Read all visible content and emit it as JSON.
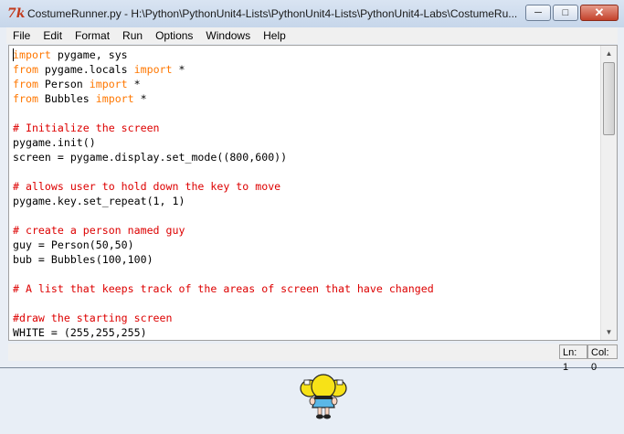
{
  "window": {
    "title": "CostumeRunner.py - H:\\Python\\PythonUnit4-Lists\\PythonUnit4-Lists\\PythonUnit4-Labs\\CostumeRu...",
    "icon": "tk-feather-icon",
    "buttons": {
      "minimize": "minimize-icon",
      "maximize": "maximize-icon",
      "close": "close-icon"
    }
  },
  "menu": {
    "items": [
      "File",
      "Edit",
      "Format",
      "Run",
      "Options",
      "Windows",
      "Help"
    ]
  },
  "editor": {
    "lines": [
      [
        {
          "t": "import",
          "c": "kw"
        },
        {
          "t": " pygame, sys",
          "c": ""
        }
      ],
      [
        {
          "t": "from",
          "c": "kw"
        },
        {
          "t": " pygame.locals ",
          "c": ""
        },
        {
          "t": "import",
          "c": "kw"
        },
        {
          "t": " *",
          "c": ""
        }
      ],
      [
        {
          "t": "from",
          "c": "kw"
        },
        {
          "t": " Person ",
          "c": ""
        },
        {
          "t": "import",
          "c": "kw"
        },
        {
          "t": " *",
          "c": ""
        }
      ],
      [
        {
          "t": "from",
          "c": "kw"
        },
        {
          "t": " Bubbles ",
          "c": ""
        },
        {
          "t": "import",
          "c": "kw"
        },
        {
          "t": " *",
          "c": ""
        }
      ],
      [],
      [
        {
          "t": "# Initialize the screen",
          "c": "cm"
        }
      ],
      [
        {
          "t": "pygame.init()",
          "c": ""
        }
      ],
      [
        {
          "t": "screen = pygame.display.set_mode((800,600))",
          "c": ""
        }
      ],
      [],
      [
        {
          "t": "# allows user to hold down the key to move",
          "c": "cm"
        }
      ],
      [
        {
          "t": "pygame.key.set_repeat(1, 1)",
          "c": ""
        }
      ],
      [],
      [
        {
          "t": "# create a person named guy",
          "c": "cm"
        }
      ],
      [
        {
          "t": "guy = Person(50,50)",
          "c": ""
        }
      ],
      [
        {
          "t": "bub = Bubbles(100,100)",
          "c": ""
        }
      ],
      [],
      [
        {
          "t": "# A list that keeps track of the areas of screen that have changed",
          "c": "cm"
        }
      ],
      [],
      [
        {
          "t": "#draw the starting screen",
          "c": "cm"
        }
      ],
      [
        {
          "t": "WHITE = (255,255,255)",
          "c": ""
        }
      ]
    ],
    "colors": {
      "keyword": "#ff7700",
      "comment": "#dd0000",
      "text": "#000000"
    }
  },
  "status": {
    "line": "Ln: 1",
    "col": "Col: 0"
  },
  "game": {
    "sprite": "bubbles-character"
  }
}
